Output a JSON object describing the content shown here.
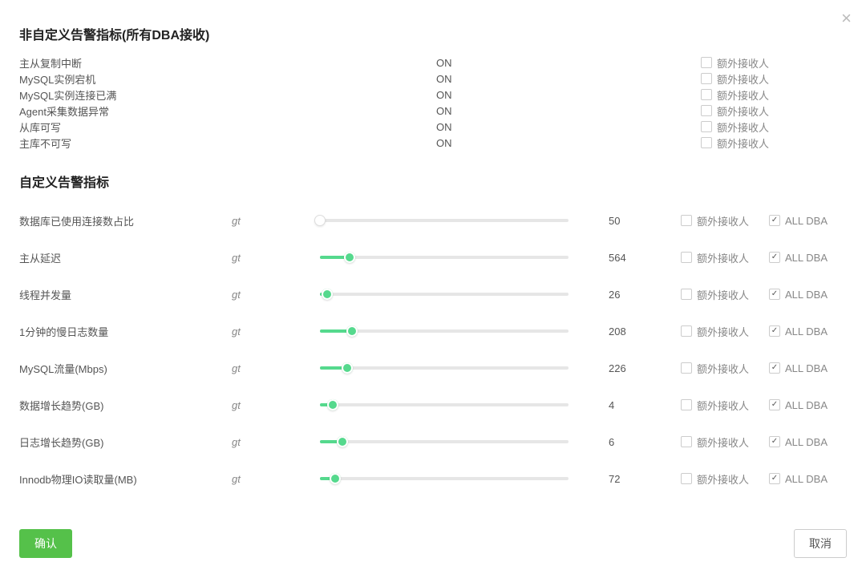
{
  "close_icon": "×",
  "nonCustom": {
    "heading": "非自定义告警指标(所有DBA接收)",
    "extraLabel": "额外接收人",
    "rows": [
      {
        "name": "主从复制中断",
        "state": "ON"
      },
      {
        "name": "MySQL实例宕机",
        "state": "ON"
      },
      {
        "name": "MySQL实例连接已满",
        "state": "ON"
      },
      {
        "name": "Agent采集数据异常",
        "state": "ON"
      },
      {
        "name": "从库可写",
        "state": "ON"
      },
      {
        "name": "主库不可写",
        "state": "ON"
      }
    ]
  },
  "custom": {
    "heading": "自定义告警指标",
    "extraLabel": "额外接收人",
    "dbaLabel": "ALL DBA",
    "rows": [
      {
        "name": "数据库已使用连接数占比",
        "op": "gt",
        "value": "50",
        "pct": 0,
        "empty": true,
        "extra": false,
        "dba": true
      },
      {
        "name": "主从延迟",
        "op": "gt",
        "value": "564",
        "pct": 12,
        "empty": false,
        "extra": false,
        "dba": true
      },
      {
        "name": "线程并发量",
        "op": "gt",
        "value": "26",
        "pct": 3,
        "empty": false,
        "extra": false,
        "dba": true
      },
      {
        "name": "1分钟的慢日志数量",
        "op": "gt",
        "value": "208",
        "pct": 13,
        "empty": false,
        "extra": false,
        "dba": true
      },
      {
        "name": "MySQL流量(Mbps)",
        "op": "gt",
        "value": "226",
        "pct": 11,
        "empty": false,
        "extra": false,
        "dba": true
      },
      {
        "name": "数据增长趋势(GB)",
        "op": "gt",
        "value": "4",
        "pct": 5,
        "empty": false,
        "extra": false,
        "dba": true
      },
      {
        "name": "日志增长趋势(GB)",
        "op": "gt",
        "value": "6",
        "pct": 9,
        "empty": false,
        "extra": false,
        "dba": true
      },
      {
        "name": "Innodb物理IO读取量(MB)",
        "op": "gt",
        "value": "72",
        "pct": 6,
        "empty": false,
        "extra": false,
        "dba": true
      }
    ]
  },
  "footer": {
    "ok": "确认",
    "cancel": "取消"
  }
}
